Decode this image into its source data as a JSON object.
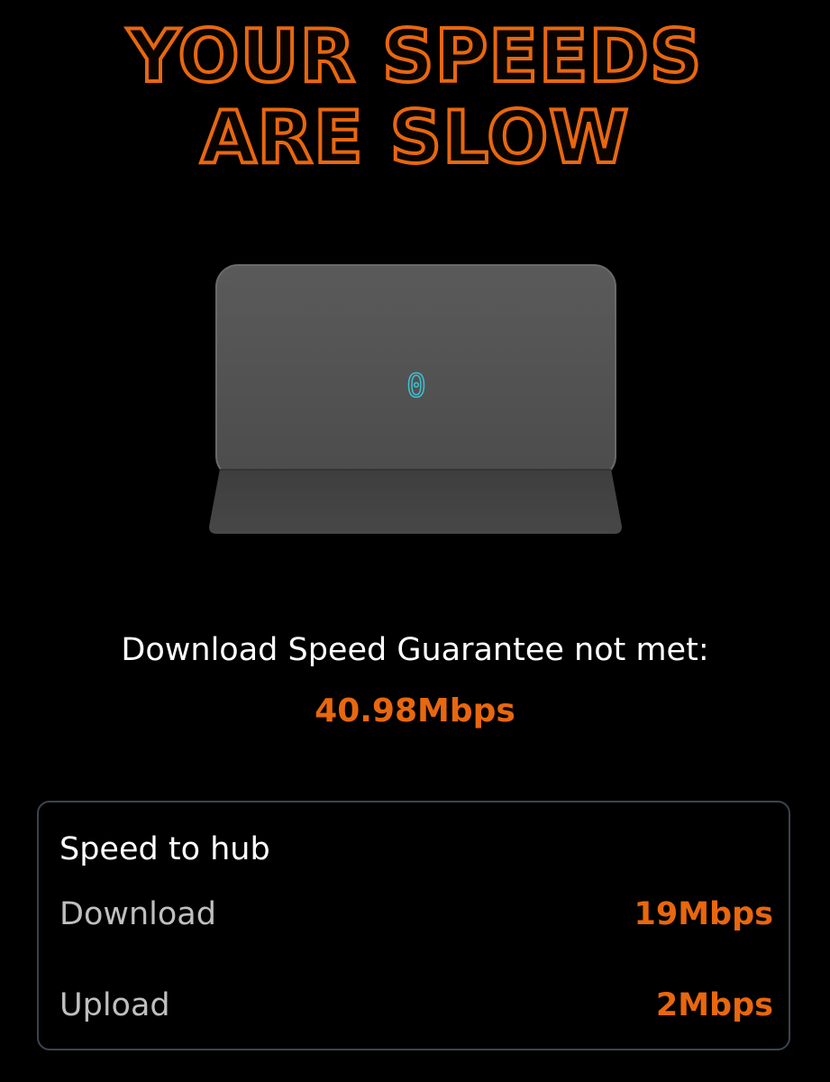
{
  "headline": {
    "line1": "YOUR SPEEDS",
    "line2": "ARE SLOW"
  },
  "hub": {
    "led_character": "0",
    "icon": "hub-router-icon",
    "led_color": "#3ec1d3"
  },
  "guarantee": {
    "label": "Download Speed Guarantee not met:",
    "value": "40.98Mbps"
  },
  "speed_to_hub": {
    "title": "Speed to hub",
    "rows": [
      {
        "label": "Download",
        "value": "19Mbps"
      },
      {
        "label": "Upload",
        "value": "2Mbps"
      }
    ]
  },
  "colors": {
    "accent": "#e8670f",
    "background": "#000000",
    "text": "#ffffff",
    "muted_text": "#bfbfbf",
    "card_border": "#3a4450"
  }
}
